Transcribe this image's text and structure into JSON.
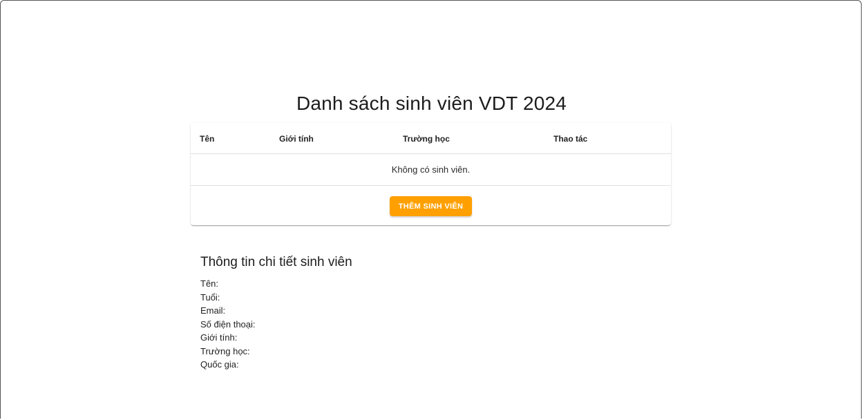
{
  "page": {
    "title": "Danh sách sinh viên VDT 2024"
  },
  "table": {
    "headers": [
      "Tên",
      "Giới tính",
      "Trường học",
      "Thao tác"
    ],
    "empty_message": "Không có sinh viên.",
    "add_button_label": "THÊM SINH VIÊN"
  },
  "details": {
    "title": "Thông tin chi tiết sinh viên",
    "fields": [
      {
        "label": "Tên:"
      },
      {
        "label": "Tuổi:"
      },
      {
        "label": "Email:"
      },
      {
        "label": "Số điện thoại:"
      },
      {
        "label": "Giới tính:"
      },
      {
        "label": "Trường học:"
      },
      {
        "label": "Quốc gia:"
      }
    ]
  },
  "colors": {
    "accent": "#ffa000",
    "divider": "#e0e0e0",
    "text": "#212121"
  }
}
